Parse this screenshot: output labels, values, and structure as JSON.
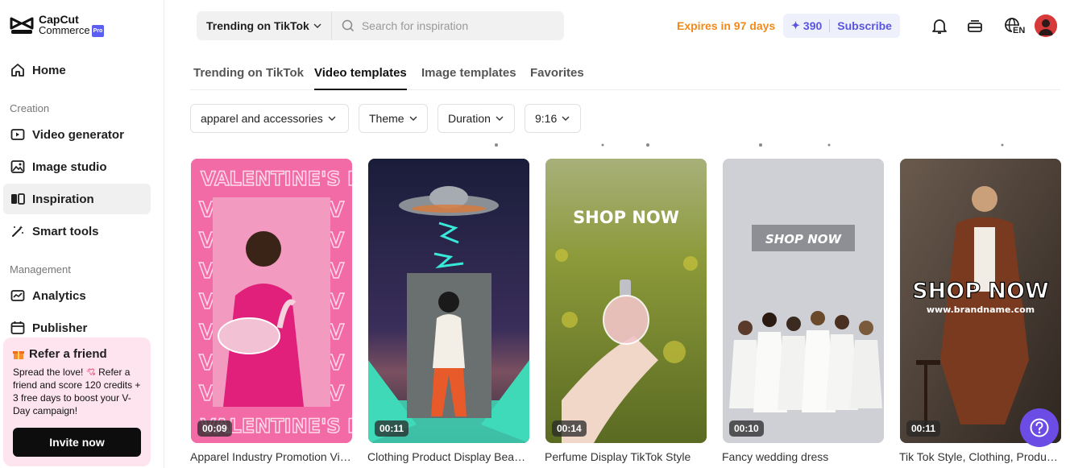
{
  "brand": {
    "name": "CapCut",
    "sub": "Commerce",
    "badge": "Pro"
  },
  "nav": {
    "home": "Home",
    "creation_label": "Creation",
    "video_generator": "Video generator",
    "image_studio": "Image studio",
    "inspiration": "Inspiration",
    "smart_tools": "Smart tools",
    "management_label": "Management",
    "analytics": "Analytics",
    "publisher": "Publisher"
  },
  "refer": {
    "title": "Refer a friend",
    "body_1": "Spread the love! ",
    "body_2": " Refer a friend and score 120 credits + 3 free days to boost your V-Day campaign!",
    "button": "Invite now"
  },
  "search": {
    "scope": "Trending on TikTok",
    "placeholder": "Search for inspiration"
  },
  "header": {
    "expires": "Expires in 97 days",
    "credits": "390",
    "subscribe": "Subscribe",
    "lang": "EN"
  },
  "tabs": [
    "Trending on TikTok",
    "Video templates",
    "Image templates",
    "Favorites"
  ],
  "filters": [
    "apparel and accessories",
    "Theme",
    "Duration",
    "9:16"
  ],
  "cards": [
    {
      "duration": "00:09",
      "caption": "Apparel Industry Promotion Video Template",
      "overlay": "VALENTINE'S DAY",
      "overlay_repeat": "V"
    },
    {
      "duration": "00:11",
      "caption": "Clothing Product Display Beauty Template"
    },
    {
      "duration": "00:14",
      "caption": "Perfume Display TikTok Style",
      "overlay": "SHOP NOW"
    },
    {
      "duration": "00:10",
      "caption": "Fancy wedding dress",
      "overlay": "SHOP NOW"
    },
    {
      "duration": "00:11",
      "caption": "Tik Tok Style, Clothing, Product Display",
      "overlay": "SHOP NOW",
      "overlay_sub": "www.brandname.com"
    }
  ],
  "colors": {
    "accent": "#5b5ef0",
    "expires": "#f08a1b",
    "refer_bg": "#fde4ee",
    "card1": "#f26aa6"
  }
}
